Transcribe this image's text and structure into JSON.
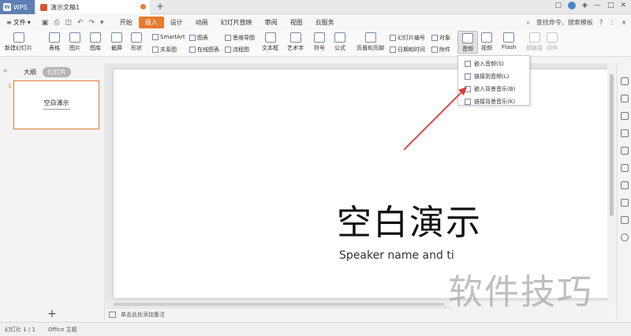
{
  "titlebar": {
    "app_label": "WPS",
    "doc_tab": "演示文稿1",
    "new_tab": "+"
  },
  "menubar": {
    "file_label": "文件",
    "menus": [
      "开始",
      "插入",
      "设计",
      "动画",
      "幻灯片放映",
      "审阅",
      "视图",
      "云服务"
    ],
    "active_menu": "插入",
    "search_placeholder": "查找命令、搜索模板",
    "help": "?"
  },
  "ribbon": {
    "new_slide": "新建幻灯片",
    "table": "表格",
    "image": "图片",
    "gallery": "图库",
    "screenshot": "截屏",
    "shape": "形状",
    "smartart": "SmartArt",
    "chart": "图表",
    "relation": "关系图",
    "online_chart": "在线图表",
    "mindmap": "思维导图",
    "flowchart": "流程图",
    "textbox": "文本框",
    "wordart": "艺术字",
    "symbol": "符号",
    "formula": "公式",
    "header_footer": "页眉和页脚",
    "slide_number": "幻灯片编号",
    "datetime": "日期和时间",
    "object": "对象",
    "attachment": "附件",
    "audio": "音频",
    "video": "视频",
    "flash": "Flash",
    "hyperlink": "超链接",
    "action": "动作"
  },
  "audio_menu": {
    "items": [
      "嵌入音频(S)",
      "链接到音频(L)",
      "嵌入背景音乐(B)",
      "链接背景音乐(K)"
    ]
  },
  "left_pane": {
    "outline_tab": "大纲",
    "slides_tab": "幻灯片",
    "slide_number": "1",
    "thumb_title": "空白演示",
    "add": "+"
  },
  "slide": {
    "title": "空白演示",
    "subtitle": "Speaker name and ti"
  },
  "notes": {
    "placeholder": "单击此处添加备注"
  },
  "statusbar": {
    "slide_info": "幻灯片 1 / 1",
    "theme": "Office 主题"
  },
  "watermark": "软件技巧",
  "colors": {
    "accent": "#e87a2d",
    "wps_blue": "#5f7fb4",
    "arrow": "#d93a3a"
  }
}
